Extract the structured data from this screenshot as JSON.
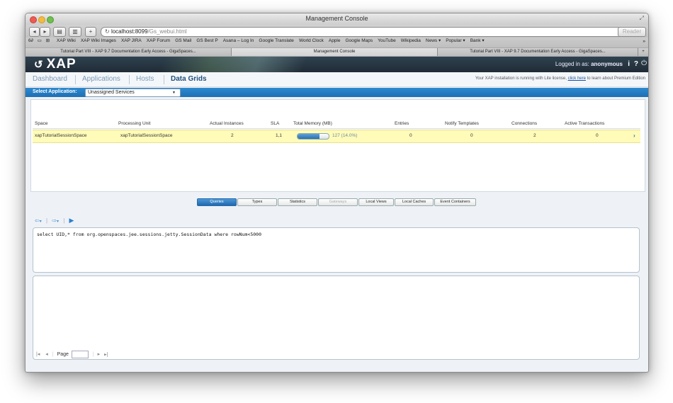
{
  "window": {
    "title": "Management Console",
    "reader_label": "Reader"
  },
  "browser": {
    "url_host": "localhost:8099",
    "url_path": "/Gs_webui.html",
    "bookmarks": [
      "XAP Wiki",
      "XAP Wiki Images",
      "XAP JIRA",
      "XAP Forum",
      "GS Mail",
      "GS Best P",
      "Asana – Log In",
      "Google Translate",
      "World Clock",
      "Apple",
      "Google Maps",
      "YouTube",
      "Wikipedia",
      "News ▾",
      "Popular ▾",
      "Bank ▾"
    ],
    "tabs": [
      {
        "label": "Tutorial Part VIII - XAP 9.7 Documentation Early Access - GigaSpaces..."
      },
      {
        "label": "Management Console"
      },
      {
        "label": "Tutorial Part VIII - XAP 9.7 Documentation Early Access - GigaSpaces..."
      }
    ],
    "new_tab_label": "+"
  },
  "app": {
    "logo_text": "XAP",
    "logged_in_prefix": "Logged in as:",
    "user": "anonymous",
    "header_icons": {
      "info": "i",
      "help": "?"
    },
    "nav": [
      {
        "label": "Dashboard"
      },
      {
        "label": "Applications"
      },
      {
        "label": "Hosts"
      },
      {
        "label": "Data Grids"
      }
    ],
    "license_text_before": "Your XAP installation is running with Lite license, ",
    "license_link": "click here",
    "license_text_after": " to learn about Premium Edition",
    "select_app_label": "Select Application:",
    "select_app_value": "Unassigned Services"
  },
  "spaces_table": {
    "headers": [
      "Space",
      "Processing Unit",
      "Actual Instances",
      "SLA",
      "Total Memory (MB)",
      "Entries",
      "Notify Templates",
      "Connections",
      "Active Transactions"
    ],
    "rows": [
      {
        "space": "xapTutorialSessionSpace",
        "processing_unit": "xapTutorialSessionSpace",
        "actual_instances": "2",
        "sla": "1,1",
        "memory_text": "127 (14.0%)",
        "memory_fraction": 0.14,
        "entries": "0",
        "notify_templates": "0",
        "connections": "2",
        "active_transactions": "0"
      }
    ]
  },
  "sub_tabs": [
    {
      "label": "Queries"
    },
    {
      "label": "Types"
    },
    {
      "label": "Statistics"
    },
    {
      "label": "Gateways"
    },
    {
      "label": "Local Views"
    },
    {
      "label": "Local Caches"
    },
    {
      "label": "Event Containers"
    }
  ],
  "query": {
    "text": "select UID,* from org.openspaces.jee.sessions.jetty.SessionData where rowNum<5000"
  },
  "pager": {
    "first": "|◂",
    "prev": "◂",
    "page_label": "Page",
    "next": "▸",
    "last": "▸|"
  },
  "colors": {
    "header_bg": "#25323e",
    "nav_active": "#1f4f7c",
    "select_bar": "#2a82c8",
    "selected_row": "#fffbb9",
    "active_tab": "#2f80c6"
  }
}
